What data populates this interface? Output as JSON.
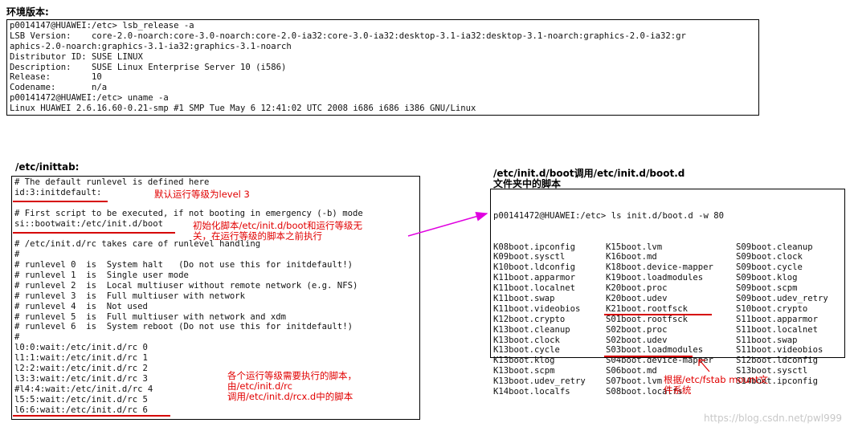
{
  "env": {
    "heading": "环境版本:",
    "lines": [
      "p0014147@HUAWEI:/etc> lsb_release -a",
      "LSB Version:    core-2.0-noarch:core-3.0-noarch:core-2.0-ia32:core-3.0-ia32:desktop-3.1-ia32:desktop-3.1-noarch:graphics-2.0-ia32:gr",
      "aphics-2.0-noarch:graphics-3.1-ia32:graphics-3.1-noarch",
      "Distributor ID: SUSE LINUX",
      "Description:    SUSE Linux Enterprise Server 10 (i586)",
      "Release:        10",
      "Codename:       n/a",
      "p00141472@HUAWEI:/etc> uname -a",
      "Linux HUAWEI 2.6.16.60-0.21-smp #1 SMP Tue May 6 12:41:02 UTC 2008 i686 i686 i386 GNU/Linux"
    ]
  },
  "inittab": {
    "heading": "/etc/inittab:",
    "lines": [
      "# The default runlevel is defined here",
      "id:3:initdefault:",
      "",
      "# First script to be executed, if not booting in emergency (-b) mode",
      "si::bootwait:/etc/init.d/boot",
      "",
      "# /etc/init.d/rc takes care of runlevel handling",
      "#",
      "# runlevel 0  is  System halt   (Do not use this for initdefault!)",
      "# runlevel 1  is  Single user mode",
      "# runlevel 2  is  Local multiuser without remote network (e.g. NFS)",
      "# runlevel 3  is  Full multiuser with network",
      "# runlevel 4  is  Not used",
      "# runlevel 5  is  Full multiuser with network and xdm",
      "# runlevel 6  is  System reboot (Do not use this for initdefault!)",
      "#",
      "l0:0:wait:/etc/init.d/rc 0",
      "l1:1:wait:/etc/init.d/rc 1",
      "l2:2:wait:/etc/init.d/rc 2",
      "l3:3:wait:/etc/init.d/rc 3",
      "#l4:4:wait:/etc/init.d/rc 4",
      "l5:5:wait:/etc/init.d/rc 5",
      "l6:6:wait:/etc/init.d/rc 6"
    ],
    "note_default": "默认运行等级为level 3",
    "note_boot_1": "初始化脚本/etc/init.d/boot和运行等级无",
    "note_boot_2": "关，在运行等级的脚本之前执行",
    "note_rc_1": "各个运行等级需要执行的脚本，",
    "note_rc_2": "由/etc/init.d/rc",
    "note_rc_3": "调用/etc/init.d/rcx.d中的脚本"
  },
  "bootd": {
    "heading_1": "/etc/init.d/boot调用/etc/init.d/boot.d",
    "heading_2": "文件夹中的脚本",
    "command": "p00141472@HUAWEI:/etc> ls init.d/boot.d -w 80",
    "col1": [
      "K08boot.ipconfig",
      "K09boot.sysctl",
      "K10boot.ldconfig",
      "K11boot.apparmor",
      "K11boot.localnet",
      "K11boot.swap",
      "K11boot.videobios",
      "K12boot.crypto",
      "K13boot.cleanup",
      "K13boot.clock",
      "K13boot.cycle",
      "K13boot.klog",
      "K13boot.scpm",
      "K13boot.udev_retry",
      "K14boot.localfs"
    ],
    "col2": [
      "K15boot.lvm",
      "K16boot.md",
      "K18boot.device-mapper",
      "K19boot.loadmodules",
      "K20boot.proc",
      "K20boot.udev",
      "K21boot.rootfsck",
      "S01boot.rootfsck",
      "S02boot.proc",
      "S02boot.udev",
      "S03boot.loadmodules",
      "S04boot.device-mapper",
      "S06boot.md",
      "S07boot.lvm",
      "S08boot.localfs"
    ],
    "col3": [
      "S09boot.cleanup",
      "S09boot.clock",
      "S09boot.cycle",
      "S09boot.klog",
      "S09boot.scpm",
      "S09boot.udev_retry",
      "S10boot.crypto",
      "S11boot.apparmor",
      "S11boot.localnet",
      "S11boot.swap",
      "S11boot.videobios",
      "S12boot.ldconfig",
      "S13boot.sysctl",
      "S14boot.ipconfig"
    ],
    "note_fstab_1": "根据/etc/fstab mount文",
    "note_fstab_2": "件系统"
  },
  "watermark": "https://blog.csdn.net/pwl999",
  "colors": {
    "annotation": "#e10000",
    "arrow": "#e000e0",
    "border": "#000000"
  }
}
